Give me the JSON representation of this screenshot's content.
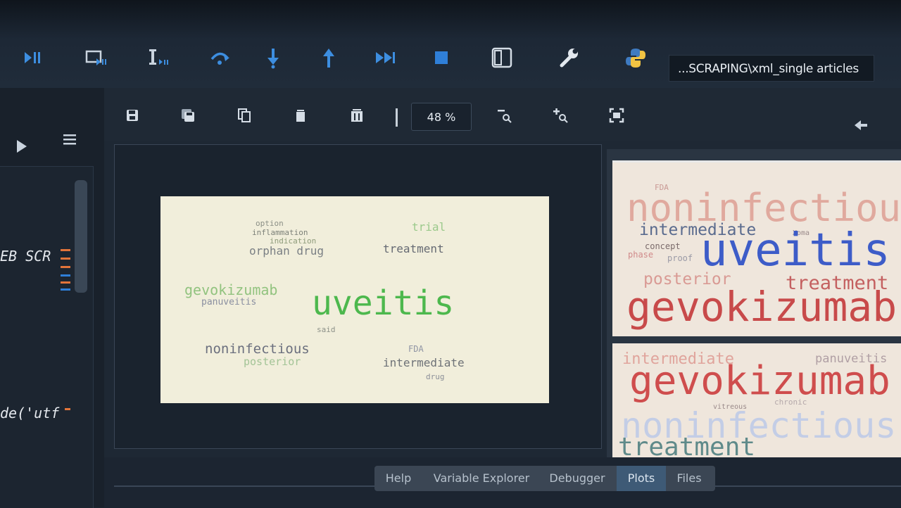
{
  "toolbar": {
    "icons": [
      "debug-run-icon",
      "run-cell-icon",
      "run-line-icon",
      "step-over-icon",
      "step-into-icon",
      "step-return-icon",
      "continue-icon",
      "stop-icon",
      "maximize-pane-icon",
      "preferences-icon",
      "python-path-icon"
    ],
    "path": "...SCRAPING\\xml_single articles"
  },
  "editor": {
    "code_line_1": "EB SCR",
    "code_line_2": "de('utf"
  },
  "plots": {
    "zoom": "48 %",
    "main_wordcloud": {
      "words": [
        "option",
        "inflammation",
        "indication",
        "trial",
        "orphan drug",
        "treatment",
        "gevokizumab",
        "uveitis",
        "panuveitis",
        "said",
        "noninfectious",
        "FDA",
        "posterior",
        "intermediate",
        "drug"
      ]
    },
    "thumbnail_1": {
      "words": [
        "FDA",
        "noninfectious",
        "intermediate",
        "Xoma",
        "concept",
        "phase",
        "proof",
        "uveitis",
        "posterior",
        "treatment",
        "gevokizumab"
      ]
    },
    "thumbnail_2": {
      "words": [
        "intermediate",
        "panuveitis",
        "gevokizumab",
        "vitreous",
        "noninfectious",
        "chronic",
        "treatment"
      ]
    }
  },
  "tabs": [
    {
      "label": "Help",
      "active": false
    },
    {
      "label": "Variable Explorer",
      "active": false
    },
    {
      "label": "Debugger",
      "active": false
    },
    {
      "label": "Plots",
      "active": true
    },
    {
      "label": "Files",
      "active": false
    }
  ],
  "colors": {
    "accent_blue": "#2f7fd8",
    "wordcloud_green": "#4db84d",
    "wordcloud_red": "#c84a4a",
    "wordcloud_blue": "#3d5cc8"
  }
}
